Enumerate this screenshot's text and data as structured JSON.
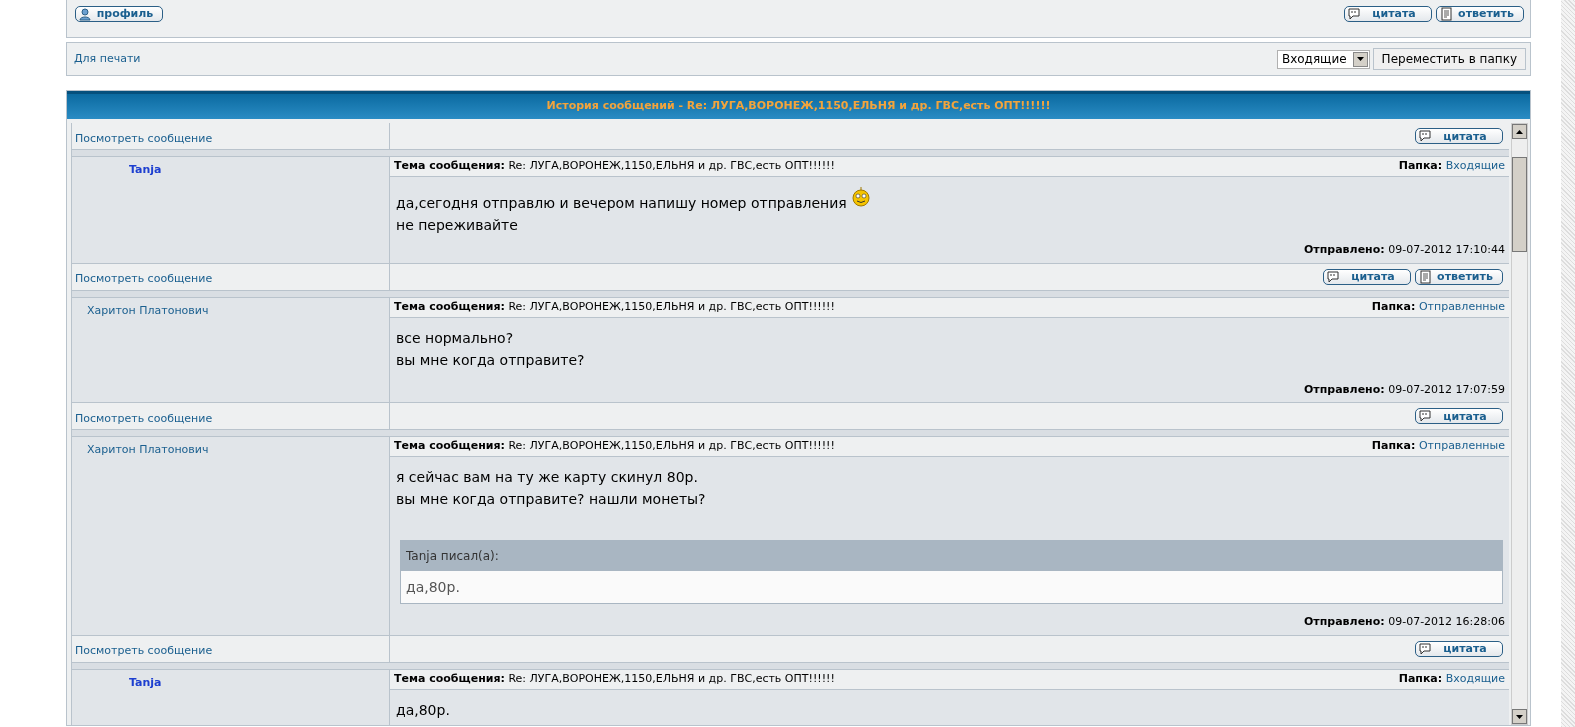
{
  "top_bar": {
    "profile_button": "профиль",
    "buttons": [
      {
        "kind": "quote",
        "label": "цитата"
      },
      {
        "kind": "reply",
        "label": "ответить"
      }
    ]
  },
  "print_bar": {
    "print_link": "Для печати",
    "folder_select": "Входящие",
    "move_button": "Переместить в папку"
  },
  "history": {
    "title": "История сообщений - Re: ЛУГА,ВОРОНЕЖ,1150,ЕЛЬНЯ и др. ГВС,есть ОПТ!!!!!!",
    "messages": [
      {
        "view_link": "Посмотреть сообщение",
        "buttons": [
          {
            "kind": "quote",
            "label": "цитата"
          }
        ],
        "author": "Tanja",
        "author_highlighted": true,
        "subject_label": "Тема сообщения:",
        "subject": "Re: ЛУГА,ВОРОНЕЖ,1150,ЕЛЬНЯ и др. ГВС,есть ОПТ!!!!!!",
        "folder_label": "Папка:",
        "folder": "Входящие",
        "lines": [
          {
            "text": "да,сегодня отправлю и вечером напишу номер отправления",
            "emoticon": true
          },
          {
            "text": "не переживайте",
            "emoticon": false
          }
        ],
        "sent_label": "Отправлено:",
        "sent": "09-07-2012 17:10:44"
      },
      {
        "view_link": "Посмотреть сообщение",
        "buttons": [
          {
            "kind": "quote",
            "label": "цитата"
          },
          {
            "kind": "reply",
            "label": "ответить"
          }
        ],
        "author": "Харитон Платонович",
        "author_highlighted": false,
        "subject_label": "Тема сообщения:",
        "subject": "Re: ЛУГА,ВОРОНЕЖ,1150,ЕЛЬНЯ и др. ГВС,есть ОПТ!!!!!!",
        "folder_label": "Папка:",
        "folder": "Отправленные",
        "lines": [
          {
            "text": "все нормально?",
            "emoticon": false
          },
          {
            "text": "вы мне когда отправите?",
            "emoticon": false
          }
        ],
        "sent_label": "Отправлено:",
        "sent": "09-07-2012 17:07:59"
      },
      {
        "view_link": "Посмотреть сообщение",
        "buttons": [
          {
            "kind": "quote",
            "label": "цитата"
          }
        ],
        "author": "Харитон Платонович",
        "author_highlighted": false,
        "subject_label": "Тема сообщения:",
        "subject": "Re: ЛУГА,ВОРОНЕЖ,1150,ЕЛЬНЯ и др. ГВС,есть ОПТ!!!!!!",
        "folder_label": "Папка:",
        "folder": "Отправленные",
        "lines": [
          {
            "text": "я сейчас вам на ту же карту скинул 80р.",
            "emoticon": false
          },
          {
            "text": "вы мне когда отправите? нашли монеты?",
            "emoticon": false
          }
        ],
        "quote": {
          "author_line": "Tanja писал(a):",
          "text": "да,80р."
        },
        "sent_label": "Отправлено:",
        "sent": "09-07-2012 16:28:06"
      },
      {
        "view_link": "Посмотреть сообщение",
        "buttons": [
          {
            "kind": "quote",
            "label": "цитата"
          }
        ],
        "author": "Tanja",
        "author_highlighted": true,
        "subject_label": "Тема сообщения:",
        "subject": "Re: ЛУГА,ВОРОНЕЖ,1150,ЕЛЬНЯ и др. ГВС,есть ОПТ!!!!!!",
        "folder_label": "Папка:",
        "folder": "Входящие",
        "lines": [
          {
            "text": "да,80р.",
            "emoticon": false
          }
        ]
      }
    ]
  }
}
